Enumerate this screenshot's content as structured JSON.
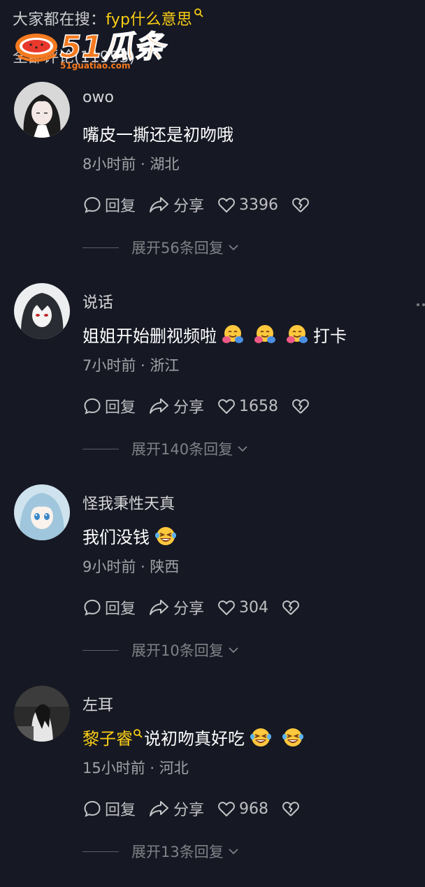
{
  "search": {
    "prefix": "大家都在搜：",
    "keyword": "fyp什么意思"
  },
  "header": {
    "comment_count_label": "全部评论(11953)"
  },
  "watermark": {
    "brand": "51瓜条",
    "domain": "51guatiao.com"
  },
  "labels": {
    "reply": "回复",
    "share": "分享"
  },
  "colors": {
    "background": "#161823",
    "accent_yellow": "#FACE15"
  },
  "comments": [
    {
      "username": "owo",
      "text": "嘴皮一撕还是初吻哦",
      "meta": "8小时前 · 湖北",
      "likes": "3396",
      "expand": "展开56条回复"
    },
    {
      "username": "说话",
      "text_before": "姐姐开始删视频啦",
      "emojis": [
        "hugging-face",
        "hugging-face",
        "hugging-face"
      ],
      "text_after": "打卡",
      "meta": "7小时前 · 浙江",
      "likes": "1658",
      "expand": "展开140条回复"
    },
    {
      "username": "怪我秉性天真",
      "text": "我们没钱",
      "emojis": [
        "laughing-crying-face"
      ],
      "meta": "9小时前 · 陕西",
      "likes": "304",
      "expand": "展开10条回复"
    },
    {
      "username": "左耳",
      "mention": "黎子睿",
      "text": "说初吻真好吃",
      "emojis": [
        "laughing-crying-face",
        "laughing-crying-face"
      ],
      "meta": "15小时前 · 河北",
      "likes": "968",
      "expand": "展开13条回复"
    }
  ]
}
